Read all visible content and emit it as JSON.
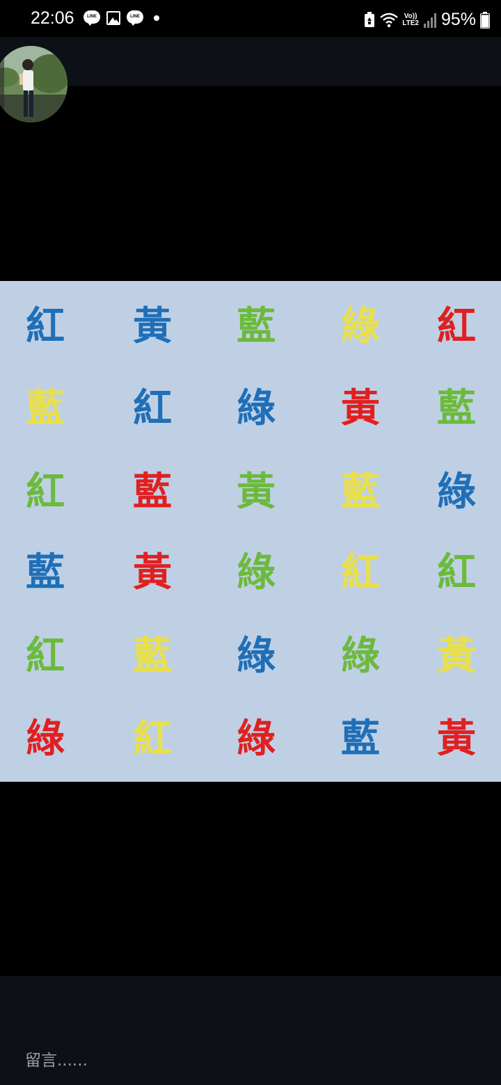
{
  "status_bar": {
    "time": "22:06",
    "line_icon_label": "LINE",
    "notification_icons": [
      "line-icon",
      "gallery-icon",
      "line-icon",
      "dot-icon"
    ],
    "system_icons": [
      "battery-saver-icon",
      "wifi-icon",
      "volte-lte2-icon",
      "signal-icon",
      "battery-icon"
    ],
    "lte_top": "Vo))",
    "lte_bottom": "LTE2",
    "battery_percent": "95%",
    "battery_level": 0.95
  },
  "profile": {
    "avatar_icon": "user-avatar"
  },
  "stroop_grid": {
    "colors": {
      "blue": "#1f6fb8",
      "yellow": "#e9e04a",
      "green": "#6cba3c",
      "red": "#e02020"
    },
    "rows": [
      [
        {
          "char": "紅",
          "color": "blue"
        },
        {
          "char": "黃",
          "color": "blue"
        },
        {
          "char": "藍",
          "color": "green"
        },
        {
          "char": "綠",
          "color": "yellow"
        },
        {
          "char": "紅",
          "color": "red"
        }
      ],
      [
        {
          "char": "藍",
          "color": "yellow"
        },
        {
          "char": "紅",
          "color": "blue"
        },
        {
          "char": "綠",
          "color": "blue"
        },
        {
          "char": "黃",
          "color": "red"
        },
        {
          "char": "藍",
          "color": "green"
        }
      ],
      [
        {
          "char": "紅",
          "color": "green"
        },
        {
          "char": "藍",
          "color": "red"
        },
        {
          "char": "黃",
          "color": "green"
        },
        {
          "char": "藍",
          "color": "yellow"
        },
        {
          "char": "綠",
          "color": "blue"
        }
      ],
      [
        {
          "char": "藍",
          "color": "blue"
        },
        {
          "char": "黃",
          "color": "red"
        },
        {
          "char": "綠",
          "color": "green"
        },
        {
          "char": "紅",
          "color": "yellow"
        },
        {
          "char": "紅",
          "color": "green"
        }
      ],
      [
        {
          "char": "紅",
          "color": "green"
        },
        {
          "char": "藍",
          "color": "yellow"
        },
        {
          "char": "綠",
          "color": "blue"
        },
        {
          "char": "綠",
          "color": "green"
        },
        {
          "char": "黃",
          "color": "yellow"
        }
      ],
      [
        {
          "char": "綠",
          "color": "red"
        },
        {
          "char": "紅",
          "color": "yellow"
        },
        {
          "char": "綠",
          "color": "red"
        },
        {
          "char": "藍",
          "color": "blue"
        },
        {
          "char": "黃",
          "color": "red"
        }
      ]
    ]
  },
  "comment": {
    "placeholder": "留言......",
    "value": ""
  },
  "theme": {
    "background": "#000000",
    "bar_background": "#0d1016",
    "panel_background": "#bfd0e5",
    "placeholder_color": "#9aa0a8"
  }
}
